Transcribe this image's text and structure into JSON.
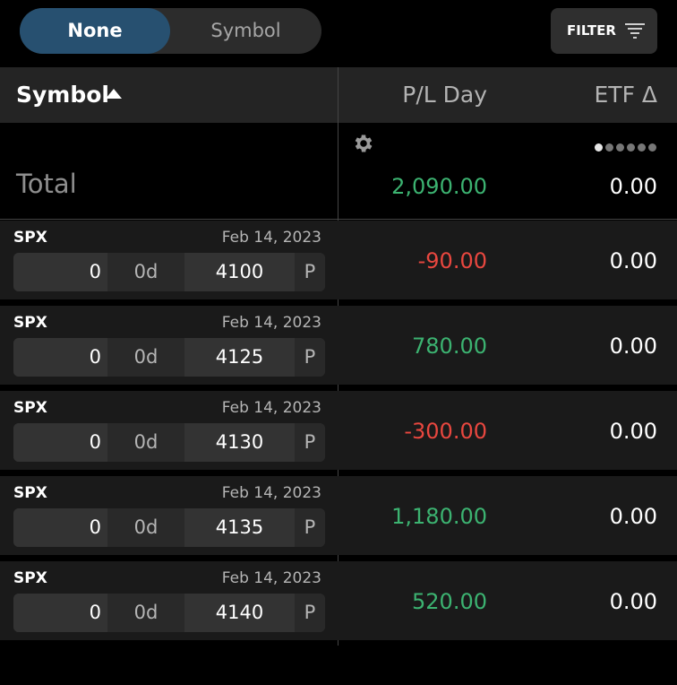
{
  "grouping": {
    "options": [
      "None",
      "Symbol"
    ],
    "selected": "None"
  },
  "filter": {
    "label": "FILTER",
    "icon": "filter-lines-icon"
  },
  "header": {
    "symbol_label": "Symbol",
    "sort_icon": "sort-ascending-icon",
    "pl_day_label": "P/L Day",
    "etf_delta_label": "ETF Δ"
  },
  "settings_icon": "gear-icon",
  "column_pages": {
    "count": 6,
    "active": 1
  },
  "total": {
    "label": "Total",
    "pl_day": "2,090.00",
    "etf_delta": "0.00"
  },
  "colors": {
    "positive": "#3cb371",
    "negative": "#e8473f",
    "accent": "#275070"
  },
  "rows": [
    {
      "symbol": "SPX",
      "date": "Feb 14, 2023",
      "quantity": "0",
      "days": "0d",
      "strike": "4100",
      "type": "P",
      "pl_day": "-90.00",
      "etf_delta": "0.00",
      "sign": "neg"
    },
    {
      "symbol": "SPX",
      "date": "Feb 14, 2023",
      "quantity": "0",
      "days": "0d",
      "strike": "4125",
      "type": "P",
      "pl_day": "780.00",
      "etf_delta": "0.00",
      "sign": "pos"
    },
    {
      "symbol": "SPX",
      "date": "Feb 14, 2023",
      "quantity": "0",
      "days": "0d",
      "strike": "4130",
      "type": "P",
      "pl_day": "-300.00",
      "etf_delta": "0.00",
      "sign": "neg"
    },
    {
      "symbol": "SPX",
      "date": "Feb 14, 2023",
      "quantity": "0",
      "days": "0d",
      "strike": "4135",
      "type": "P",
      "pl_day": "1,180.00",
      "etf_delta": "0.00",
      "sign": "pos"
    },
    {
      "symbol": "SPX",
      "date": "Feb 14, 2023",
      "quantity": "0",
      "days": "0d",
      "strike": "4140",
      "type": "P",
      "pl_day": "520.00",
      "etf_delta": "0.00",
      "sign": "pos"
    }
  ]
}
